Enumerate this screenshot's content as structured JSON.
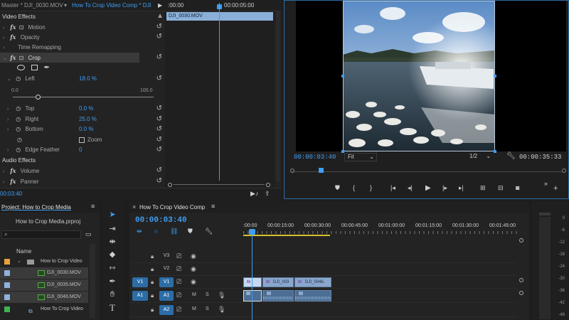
{
  "colors": {
    "accent": "#3e9ef3",
    "bg": "#1d1d1d",
    "panel": "#232323",
    "video_clip": "#8aa6cc",
    "audio_clip": "#4c6d94",
    "track_v1": "#2d6da6",
    "orange_swatch": "#e8a23c",
    "blue_swatch": "#8fb1dc",
    "green_swatch": "#3fb34f"
  },
  "effect_controls": {
    "tab_master": "Master * DJI_0030.MOV",
    "tab_seq": "How To Crop Video Comp * DJI_0030.MOV",
    "ruler_start": ":00:00",
    "ruler_mark": "00:00:05:00",
    "clip_name": "DJI_0030.MOV",
    "video_effects": "Video Effects",
    "motion": "Motion",
    "opacity": "Opacity",
    "time_remapping": "Time Remapping",
    "crop": "Crop",
    "left_label": "Left",
    "left_value": "18.0 %",
    "slider_min": "0.0",
    "slider_max": "100.0",
    "slider_value": 0.18,
    "top_label": "Top",
    "top_value": "0.0 %",
    "right_label": "Right",
    "right_value": "25.0 %",
    "bottom_label": "Bottom",
    "bottom_value": "0.0 %",
    "zoom_label": "Zoom",
    "edge_feather_label": "Edge Feather",
    "edge_feather_value": "0",
    "audio_effects": "Audio Effects",
    "volume": "Volume",
    "panner": "Panner",
    "timecode": "00:03:40",
    "fx": "fx"
  },
  "program_monitor": {
    "timecode": "00:00:03:40",
    "fit": "Fit",
    "resolution": "1/2",
    "duration": "00:00:35:33"
  },
  "project": {
    "title": "Project: How to Crop Media",
    "file": "How to Crop Media.prproj",
    "name_header": "Name",
    "items": [
      {
        "name": "How to Crop Video",
        "type": "folder",
        "swatch": "orange"
      },
      {
        "name": "DJI_0030.MOV",
        "type": "clip",
        "swatch": "blue"
      },
      {
        "name": "DJI_0035.MOV",
        "type": "clip",
        "swatch": "blue"
      },
      {
        "name": "DJI_0046.MOV",
        "type": "clip",
        "swatch": "blue"
      },
      {
        "name": "How To Crop Video",
        "type": "sequence",
        "swatch": "green"
      }
    ]
  },
  "timeline": {
    "title": "How To Crop Video Comp",
    "timecode": "00:00:03:40",
    "ruler": [
      ":00:00",
      "00:00:15:00",
      "00:00:30:00",
      "00:00:45:00",
      "00:01:00:00",
      "00:01:15:00",
      "00:01:30:00",
      "00:01:45:00"
    ],
    "tracks": [
      {
        "src": "",
        "name": "V3"
      },
      {
        "src": "",
        "name": "V2"
      },
      {
        "src": "V1",
        "name": "V1"
      },
      {
        "src": "A1",
        "name": "A1"
      },
      {
        "src": "",
        "name": "A2"
      }
    ],
    "mute": "M",
    "solo": "S",
    "clips": [
      "DJI_003",
      "DJI_0046."
    ],
    "clip_fx": "fx"
  },
  "meter": {
    "labels": [
      "0",
      "-6",
      "-12",
      "-18",
      "-24",
      "-30",
      "-36",
      "-42",
      "-48"
    ]
  }
}
